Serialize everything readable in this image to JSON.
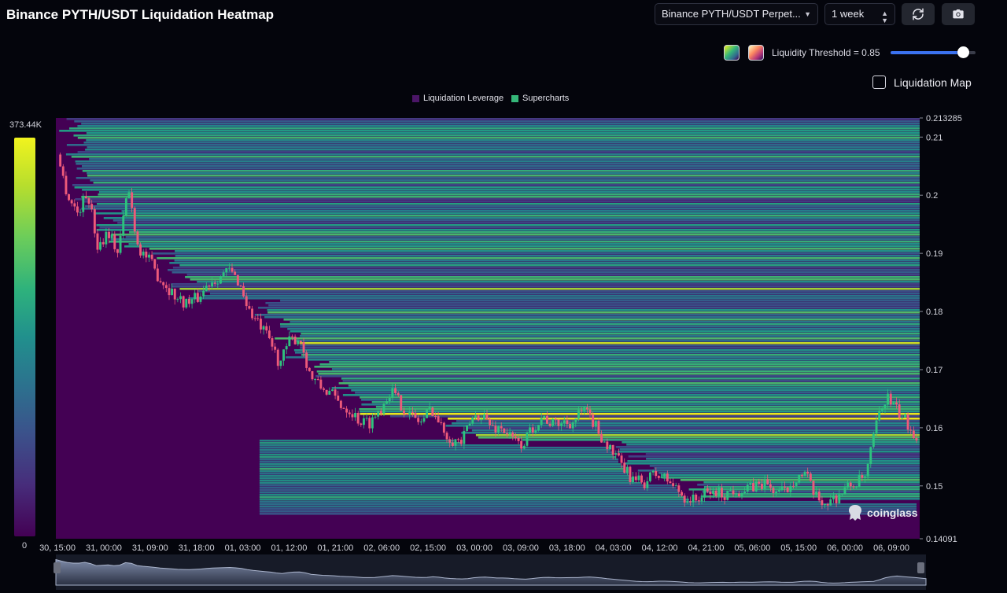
{
  "header": {
    "title": "Binance PYTH/USDT Liquidation Heatmap",
    "pair_select": "Binance PYTH/USDT Perpet...",
    "range_select": "1 week",
    "refresh_icon": "refresh-icon",
    "camera_icon": "camera-icon"
  },
  "controls": {
    "threshold_label": "Liquidity Threshold = 0.85",
    "threshold_value": 0.85,
    "map_label": "Liquidation Map",
    "map_checked": false
  },
  "colorbar": {
    "max_label": "373.44K",
    "min_label": "0"
  },
  "watermark": "coinglass",
  "colors": {
    "low": "#440154",
    "mid": "#21908d",
    "high": "#f1f31e",
    "up": "#2ec27e",
    "down": "#ee5a7a"
  },
  "chart_data": {
    "type": "heatmap",
    "title": "Binance PYTH/USDT Liquidation Heatmap",
    "legend": [
      {
        "name": "Liquidation Leverage",
        "color": "#4b1667"
      },
      {
        "name": "Supercharts",
        "color": "#35b779"
      }
    ],
    "legend_position": "top-center",
    "y_range": [
      0.14091,
      0.213285
    ],
    "y_ticks": [
      {
        "value": 0.213285,
        "label": "0.213285"
      },
      {
        "value": 0.21,
        "label": "0.21"
      },
      {
        "value": 0.2,
        "label": "0.2"
      },
      {
        "value": 0.19,
        "label": "0.19"
      },
      {
        "value": 0.18,
        "label": "0.18"
      },
      {
        "value": 0.17,
        "label": "0.17"
      },
      {
        "value": 0.16,
        "label": "0.16"
      },
      {
        "value": 0.15,
        "label": "0.15"
      },
      {
        "value": 0.14091,
        "label": "0.14091"
      }
    ],
    "x_ticks": [
      "30, 15:00",
      "31, 00:00",
      "31, 09:00",
      "31, 18:00",
      "01, 03:00",
      "01, 12:00",
      "01, 21:00",
      "02, 06:00",
      "02, 15:00",
      "03, 00:00",
      "03, 09:00",
      "03, 18:00",
      "04, 03:00",
      "04, 12:00",
      "04, 21:00",
      "05, 06:00",
      "05, 15:00",
      "06, 00:00",
      "06, 09:00"
    ],
    "price_path": [
      [
        0,
        0.207
      ],
      [
        2,
        0.2
      ],
      [
        4,
        0.197
      ],
      [
        6,
        0.2005
      ],
      [
        8,
        0.191
      ],
      [
        10,
        0.194
      ],
      [
        12,
        0.19
      ],
      [
        14,
        0.2015
      ],
      [
        16,
        0.191
      ],
      [
        18,
        0.189
      ],
      [
        20,
        0.186
      ],
      [
        22,
        0.184
      ],
      [
        24,
        0.182
      ],
      [
        26,
        0.1815
      ],
      [
        28,
        0.1825
      ],
      [
        30,
        0.185
      ],
      [
        32,
        0.186
      ],
      [
        34,
        0.187
      ],
      [
        36,
        0.185
      ],
      [
        38,
        0.18
      ],
      [
        40,
        0.1775
      ],
      [
        42,
        0.175
      ],
      [
        44,
        0.171
      ],
      [
        46,
        0.175
      ],
      [
        48,
        0.1755
      ],
      [
        50,
        0.169
      ],
      [
        52,
        0.167
      ],
      [
        54,
        0.166
      ],
      [
        56,
        0.164
      ],
      [
        58,
        0.163
      ],
      [
        60,
        0.161
      ],
      [
        62,
        0.161
      ],
      [
        64,
        0.1635
      ],
      [
        66,
        0.1665
      ],
      [
        68,
        0.164
      ],
      [
        70,
        0.162
      ],
      [
        72,
        0.161
      ],
      [
        74,
        0.1635
      ],
      [
        76,
        0.16
      ],
      [
        78,
        0.158
      ],
      [
        80,
        0.1575
      ],
      [
        82,
        0.1615
      ],
      [
        84,
        0.1625
      ],
      [
        86,
        0.16
      ],
      [
        88,
        0.16
      ],
      [
        90,
        0.158
      ],
      [
        92,
        0.157
      ],
      [
        94,
        0.16
      ],
      [
        96,
        0.162
      ],
      [
        98,
        0.1605
      ],
      [
        100,
        0.161
      ],
      [
        102,
        0.161
      ],
      [
        104,
        0.163
      ],
      [
        106,
        0.161
      ],
      [
        108,
        0.158
      ],
      [
        110,
        0.1555
      ],
      [
        112,
        0.153
      ],
      [
        114,
        0.151
      ],
      [
        116,
        0.1505
      ],
      [
        118,
        0.152
      ],
      [
        120,
        0.1515
      ],
      [
        122,
        0.15
      ],
      [
        124,
        0.148
      ],
      [
        126,
        0.1475
      ],
      [
        128,
        0.1485
      ],
      [
        130,
        0.149
      ],
      [
        132,
        0.1485
      ],
      [
        134,
        0.1495
      ],
      [
        136,
        0.149
      ],
      [
        138,
        0.15
      ],
      [
        140,
        0.1505
      ],
      [
        142,
        0.149
      ],
      [
        144,
        0.149
      ],
      [
        146,
        0.1515
      ],
      [
        148,
        0.152
      ],
      [
        150,
        0.148
      ],
      [
        152,
        0.147
      ],
      [
        154,
        0.148
      ],
      [
        156,
        0.1495
      ],
      [
        158,
        0.1505
      ],
      [
        160,
        0.1515
      ],
      [
        162,
        0.1605
      ],
      [
        164,
        0.1655
      ],
      [
        166,
        0.163
      ],
      [
        168,
        0.161
      ],
      [
        170,
        0.1585
      ]
    ]
  }
}
